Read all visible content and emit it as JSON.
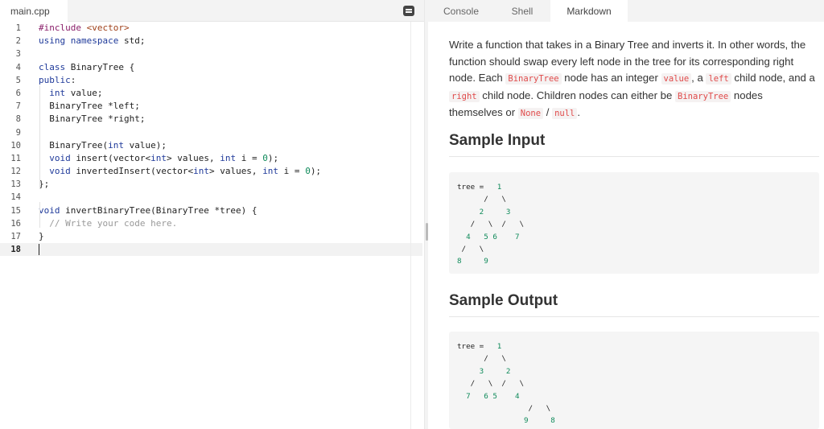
{
  "editor": {
    "file_tab": "main.cpp",
    "lines": [
      {
        "n": "1",
        "html": "<span class=\"inc\">#include</span> <span class=\"str\">&lt;vector&gt;</span>"
      },
      {
        "n": "2",
        "html": "<span class=\"kw\">using namespace</span> std;"
      },
      {
        "n": "3",
        "html": ""
      },
      {
        "n": "4",
        "html": "<span class=\"kw\">class</span> BinaryTree {"
      },
      {
        "n": "5",
        "html": "<span class=\"kw\">public</span>:"
      },
      {
        "n": "6",
        "html": "  <span class=\"kw\">int</span> value;"
      },
      {
        "n": "7",
        "html": "  BinaryTree *left;"
      },
      {
        "n": "8",
        "html": "  BinaryTree *right;"
      },
      {
        "n": "9",
        "html": ""
      },
      {
        "n": "10",
        "html": "  BinaryTree(<span class=\"kw\">int</span> value);"
      },
      {
        "n": "11",
        "html": "  <span class=\"kw\">void</span> insert(vector&lt;<span class=\"kw\">int</span>&gt; values, <span class=\"kw\">int</span> i = <span class=\"num\">0</span>);"
      },
      {
        "n": "12",
        "html": "  <span class=\"kw\">void</span> invertedInsert(vector&lt;<span class=\"kw\">int</span>&gt; values, <span class=\"kw\">int</span> i = <span class=\"num\">0</span>);"
      },
      {
        "n": "13",
        "html": "};"
      },
      {
        "n": "14",
        "html": ""
      },
      {
        "n": "15",
        "html": "<span class=\"kw\">void</span> invertBinaryTree(BinaryTree *tree) {"
      },
      {
        "n": "16",
        "html": "  <span class=\"cmt\">// Write your code here.</span>"
      },
      {
        "n": "17",
        "html": "}"
      },
      {
        "n": "18",
        "html": "<span class=\"cursor\"></span>"
      }
    ],
    "current_line": "18"
  },
  "tabs": {
    "console": "Console",
    "shell": "Shell",
    "markdown": "Markdown"
  },
  "markdown": {
    "description_html": "Write a function that takes in a Binary Tree and inverts it. In other words, the function should swap every left node in the tree for its corresponding right node. Each <span class=\"ic\">BinaryTree</span> node has an integer <span class=\"ic\">value</span>, a <span class=\"ic\">left</span> child node, and a <span class=\"ic\">right</span> child node. Children nodes can either be <span class=\"ic\">BinaryTree</span> nodes themselves or <span class=\"ic\">None</span> / <span class=\"ic\">null</span>.",
    "sample_input_heading": "Sample Input",
    "sample_output_heading": "Sample Output",
    "sample_input_html": "tree =   <span class=\"num\">1</span>\n      /   \\\n     <span class=\"num\">2</span>     <span class=\"num\">3</span>\n   /   \\  /   \\\n  <span class=\"num\">4</span>   <span class=\"num\">5</span> <span class=\"num\">6</span>    <span class=\"num\">7</span>\n /   \\\n<span class=\"num\">8</span>     <span class=\"num\">9</span>",
    "sample_output_html": "tree =   <span class=\"num\">1</span>\n      /   \\\n     <span class=\"num\">3</span>     <span class=\"num\">2</span>\n   /   \\  /   \\\n  <span class=\"num\">7</span>   <span class=\"num\">6</span> <span class=\"num\">5</span>    <span class=\"num\">4</span>\n                /   \\\n               <span class=\"num\">9</span>     <span class=\"num\">8</span>"
  }
}
